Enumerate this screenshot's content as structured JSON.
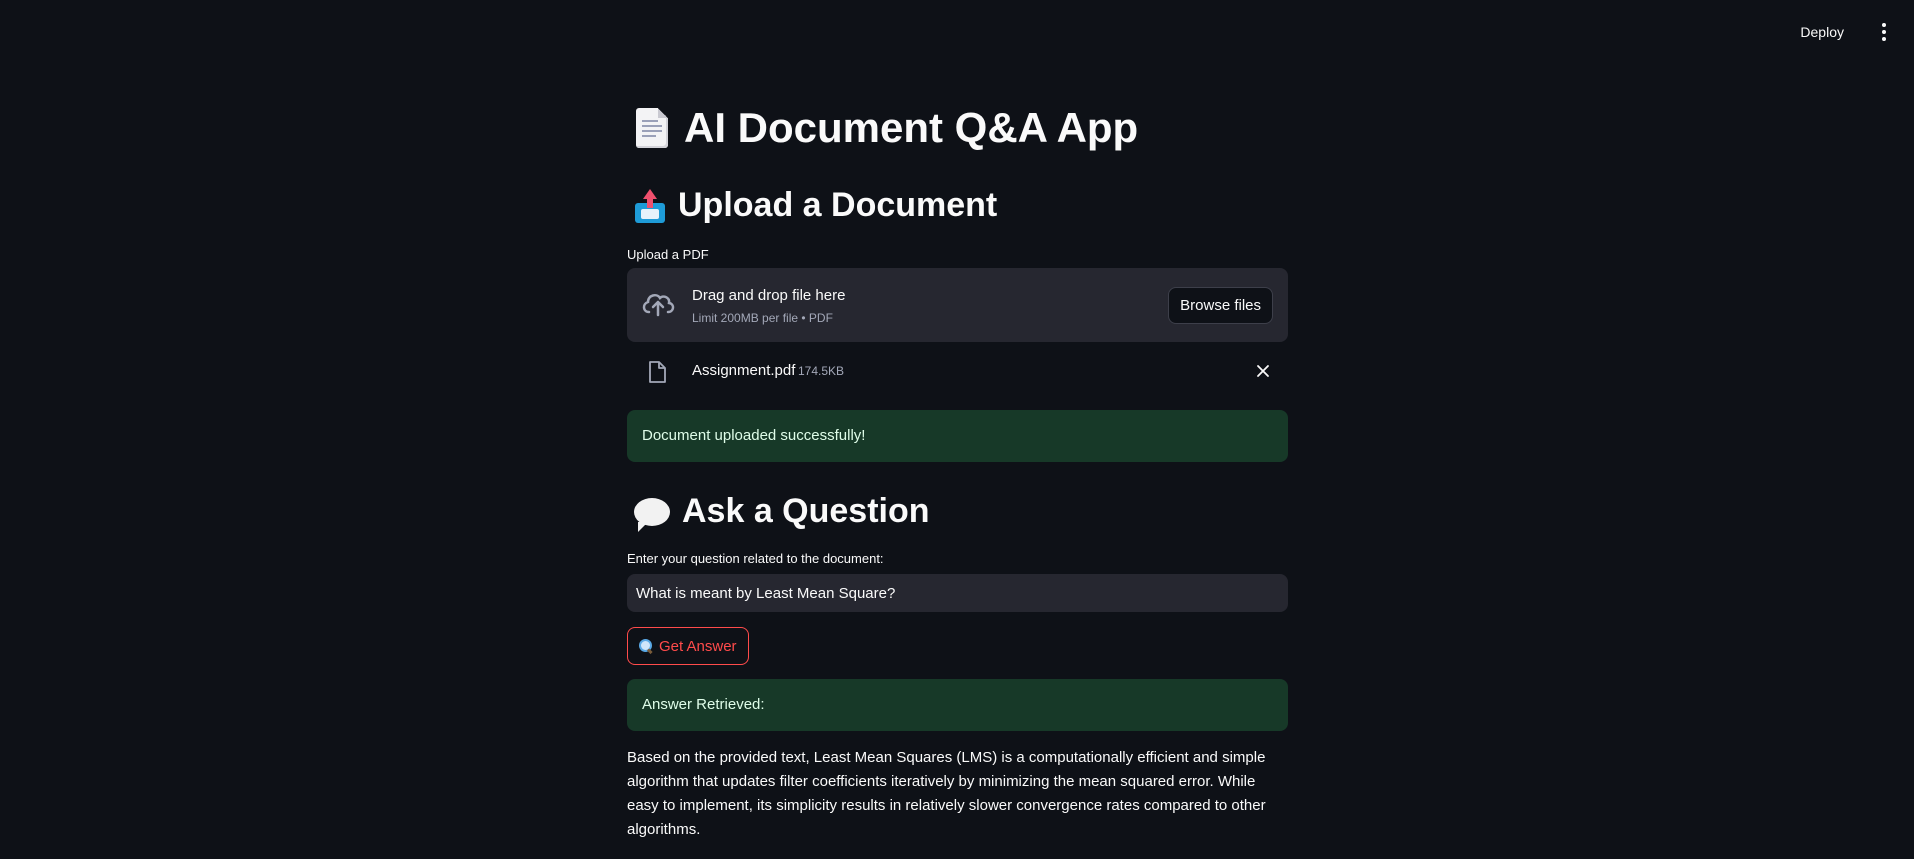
{
  "header": {
    "deploy_label": "Deploy",
    "menu_icon": "kebab-menu-icon"
  },
  "main": {
    "title": "AI Document Q&A App",
    "title_icon": "document-icon",
    "upload_section": {
      "heading": "Upload a Document",
      "heading_icon": "outbox-tray-icon",
      "field_label": "Upload a PDF",
      "dropzone": {
        "icon": "cloud-upload-icon",
        "title": "Drag and drop file here",
        "subtitle": "Limit 200MB per file • PDF",
        "browse_label": "Browse files"
      },
      "uploaded_file": {
        "icon": "file-icon",
        "name": "Assignment.pdf",
        "size": "174.5KB",
        "remove_icon": "close-icon"
      },
      "success_message": "Document uploaded successfully!"
    },
    "question_section": {
      "heading": "Ask a Question",
      "heading_icon": "speech-bubble-icon",
      "field_label": "Enter your question related to the document:",
      "question_value": "What is meant by Least Mean Square?",
      "button_icon": "magnifier-icon",
      "button_label": "Get Answer",
      "answer_header": "Answer Retrieved:",
      "answer_text": "Based on the provided text, Least Mean Squares (LMS) is a computationally efficient and simple algorithm that updates filter coefficients iteratively by minimizing the mean squared error. While easy to implement, its simplicity results in relatively slower convergence rates compared to other algorithms."
    }
  },
  "colors": {
    "background": "#0e1117",
    "surface": "#262730",
    "accent": "#ff4b4b",
    "success_bg": "#173928",
    "text": "#fafafa",
    "muted": "#a3a8b8"
  }
}
